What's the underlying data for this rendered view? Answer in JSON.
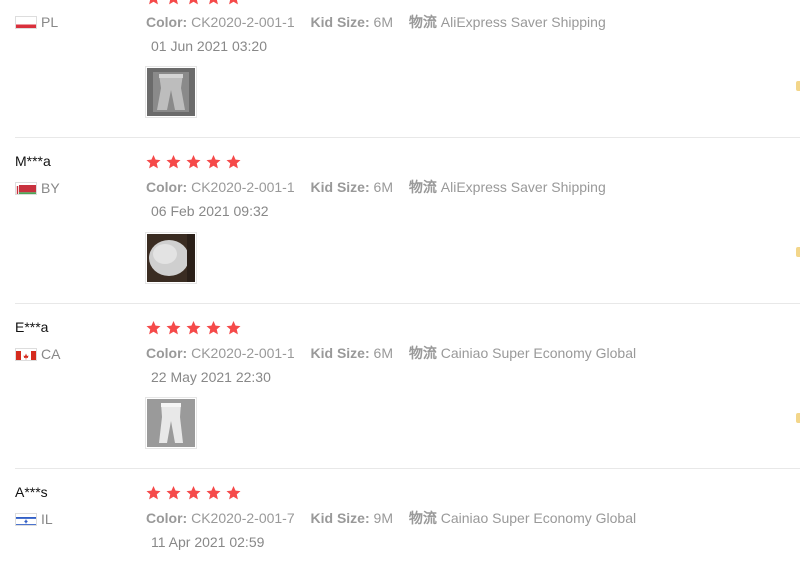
{
  "labels": {
    "color": "Color:",
    "kid_size": "Kid Size:",
    "logistics": "物流"
  },
  "reviews": [
    {
      "user": "",
      "country": "PL",
      "flag": "poland",
      "rating": 5,
      "color": "CK2020-2-001-1",
      "kid_size": "6M",
      "shipping": "AliExpress Saver Shipping",
      "date": "01 Jun 2021 03:20",
      "photo": "gray-pants-photo"
    },
    {
      "user": "M***a",
      "country": "BY",
      "flag": "belarus",
      "rating": 5,
      "color": "CK2020-2-001-1",
      "kid_size": "6M",
      "shipping": "AliExpress Saver Shipping",
      "date": "06 Feb 2021 09:32",
      "photo": "white-fabric-photo"
    },
    {
      "user": "E***a",
      "country": "CA",
      "flag": "canada",
      "rating": 5,
      "color": "CK2020-2-001-1",
      "kid_size": "6M",
      "shipping": "Cainiao Super Economy Global",
      "date": "22 May 2021 22:30",
      "photo": "light-pants-photo"
    },
    {
      "user": "A***s",
      "country": "IL",
      "flag": "israel",
      "rating": 5,
      "color": "CK2020-2-001-7",
      "kid_size": "9M",
      "shipping": "Cainiao Super Economy Global",
      "date": "11 Apr 2021 02:59",
      "photo": ""
    }
  ],
  "colors": {
    "star": "#f54a4a",
    "text_muted": "#999999",
    "divider": "#e8e8e8"
  }
}
